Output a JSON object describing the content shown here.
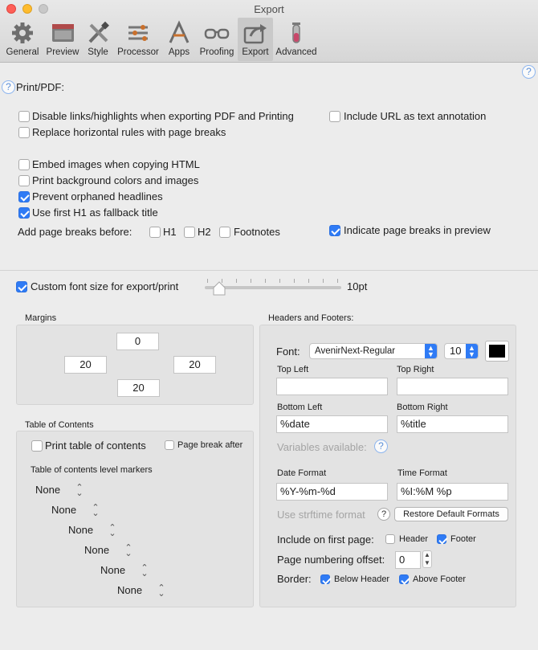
{
  "window": {
    "title": "Export"
  },
  "toolbar": [
    {
      "label": "General",
      "icon": "gear-icon"
    },
    {
      "label": "Preview",
      "icon": "preview-window-icon"
    },
    {
      "label": "Style",
      "icon": "tools-icon"
    },
    {
      "label": "Processor",
      "icon": "sliders-icon"
    },
    {
      "label": "Apps",
      "icon": "apps-icon"
    },
    {
      "label": "Proofing",
      "icon": "glasses-icon"
    },
    {
      "label": "Export",
      "icon": "export-icon"
    },
    {
      "label": "Advanced",
      "icon": "flask-icon"
    }
  ],
  "active_tab": "Export",
  "print": {
    "section_label": "Print/PDF:",
    "disable_links": {
      "label": "Disable links/highlights when exporting PDF and Printing",
      "checked": false
    },
    "include_url": {
      "label": "Include URL as text annotation",
      "checked": false
    },
    "replace_hr": {
      "label": "Replace horizontal rules with page breaks",
      "checked": false
    },
    "embed_images": {
      "label": "Embed images when copying HTML",
      "checked": false
    },
    "print_bg": {
      "label": "Print background colors and images",
      "checked": false
    },
    "prevent_orphans": {
      "label": "Prevent orphaned headlines",
      "checked": true
    },
    "first_h1": {
      "label": "Use first H1 as fallback title",
      "checked": true
    },
    "page_breaks_label": "Add page breaks before:",
    "pb_h1": {
      "label": "H1",
      "checked": false
    },
    "pb_h2": {
      "label": "H2",
      "checked": false
    },
    "pb_footnotes": {
      "label": "Footnotes",
      "checked": false
    },
    "indicate_breaks": {
      "label": "Indicate page breaks in preview",
      "checked": true
    }
  },
  "font_size": {
    "label": "Custom font size for export/print",
    "checked": true,
    "value_label": "10pt",
    "value": 10
  },
  "margins": {
    "title": "Margins",
    "top": "0",
    "left": "20",
    "right": "20",
    "bottom": "20"
  },
  "toc": {
    "title": "Table of Contents",
    "print_toc": {
      "label": "Print table of contents",
      "checked": false
    },
    "page_break_after": {
      "label": "Page break after",
      "checked": false
    },
    "markers_label": "Table of contents level markers",
    "levels": [
      "None",
      "None",
      "None",
      "None",
      "None",
      "None"
    ]
  },
  "headers": {
    "title": "Headers and Footers:",
    "font_label": "Font:",
    "font_name": "AvenirNext-Regular",
    "font_size": "10",
    "font_color": "#000000",
    "top_left_label": "Top Left",
    "top_left_value": "",
    "top_right_label": "Top Right",
    "top_right_value": "",
    "bottom_left_label": "Bottom Left",
    "bottom_left_value": "%date",
    "bottom_right_label": "Bottom Right",
    "bottom_right_value": "%title",
    "variables_label": "Variables available:",
    "date_format_label": "Date Format",
    "date_format_value": "%Y-%m-%d",
    "time_format_label": "Time Format",
    "time_format_value": "%I:%M %p",
    "strftime_label": "Use strftime format",
    "restore_button": "Restore Default Formats",
    "first_page_label": "Include on first page:",
    "first_page_header": {
      "label": "Header",
      "checked": false
    },
    "first_page_footer": {
      "label": "Footer",
      "checked": true
    },
    "numbering_label": "Page numbering offset:",
    "numbering_value": "0",
    "border_label": "Border:",
    "below_header": {
      "label": "Below Header",
      "checked": true
    },
    "above_footer": {
      "label": "Above Footer",
      "checked": true
    }
  }
}
